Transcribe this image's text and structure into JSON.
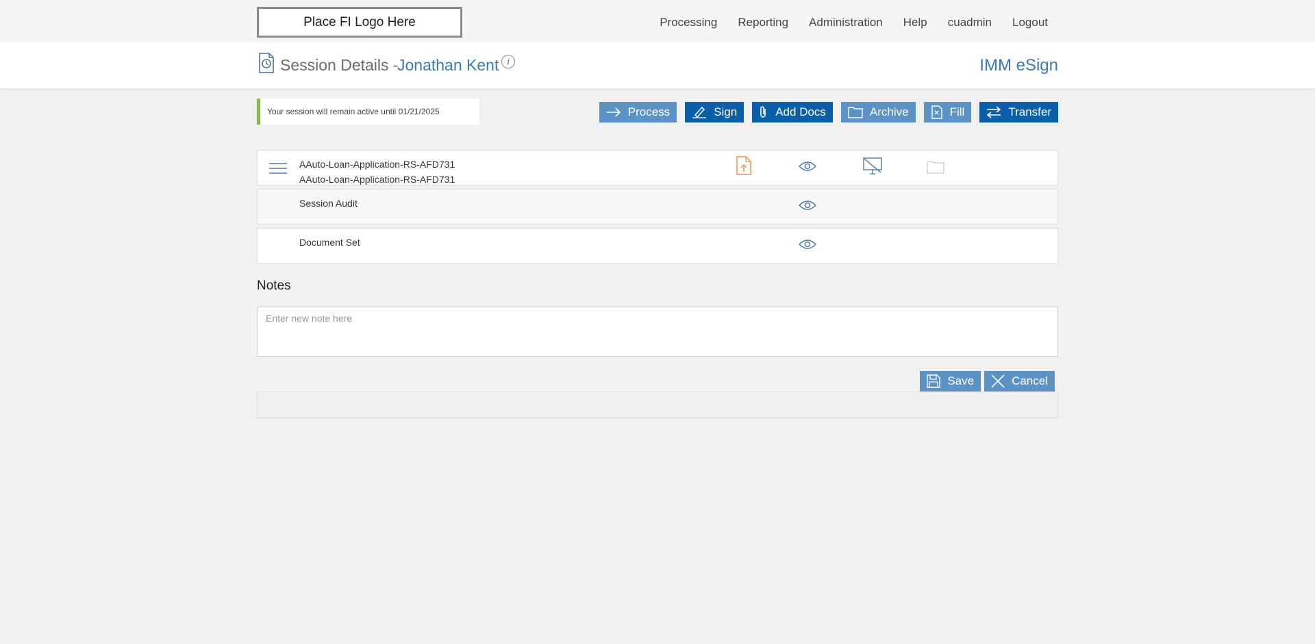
{
  "header": {
    "logo_text": "Place FI Logo Here",
    "nav": [
      "Processing",
      "Reporting",
      "Administration",
      "Help",
      "cuadmin",
      "Logout"
    ]
  },
  "title": {
    "prefix": "Session Details -",
    "name": "Jonathan Kent",
    "info": "i",
    "app_name": "IMM eSign"
  },
  "banner": {
    "text": "Your session will remain active until 01/21/2025"
  },
  "actions": {
    "process": "Process",
    "sign": "Sign",
    "add_docs": "Add Docs",
    "archive": "Archive",
    "fill": "Fill",
    "transfer": "Transfer"
  },
  "rows": [
    {
      "line1": "AAuto-Loan-Application-RS-AFD731",
      "line2": "AAuto-Loan-Application-RS-AFD731"
    },
    {
      "line1": "Session Audit"
    },
    {
      "line1": "Document Set"
    }
  ],
  "notes": {
    "title": "Notes",
    "placeholder": "Enter new note here",
    "save": "Save",
    "cancel": "Cancel"
  },
  "colors": {
    "accent": "#3a79b3",
    "button_light": "#5b93c6",
    "button_dark": "#0a5fa8",
    "banner_border": "#7cc242",
    "upload_icon": "#f08a4b"
  }
}
